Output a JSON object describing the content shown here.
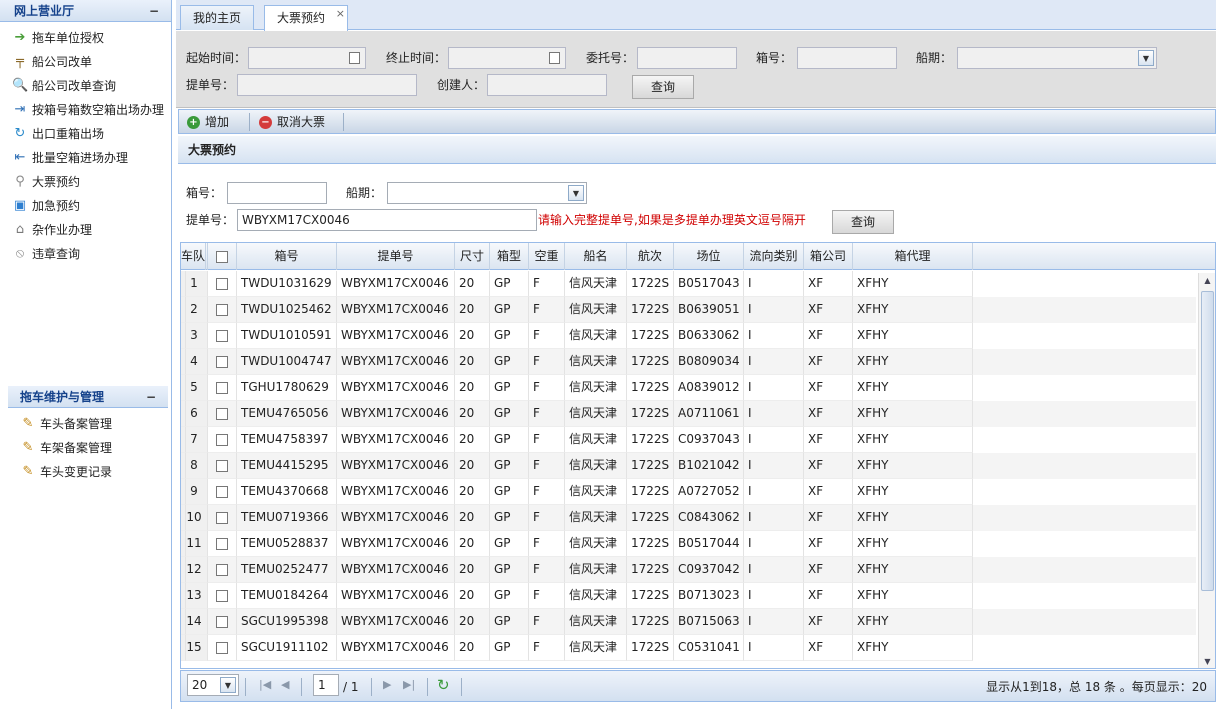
{
  "sidebar": {
    "title": "网上营业厅",
    "collapse": "−",
    "items": [
      {
        "label": "拖车单位授权",
        "icon": "arrow-right-icon",
        "glyph": "➔",
        "color": "#4a9e3a"
      },
      {
        "label": "船公司改单",
        "icon": "hammer-icon",
        "glyph": "╤",
        "color": "#8b6a2b"
      },
      {
        "label": "船公司改单查询",
        "icon": "magnifier-icon",
        "glyph": "🔍",
        "color": "#555"
      },
      {
        "label": "按箱号箱数空箱出场办理",
        "icon": "door-out-icon",
        "glyph": "⇥",
        "color": "#2f6fb5"
      },
      {
        "label": "出口重箱出场",
        "icon": "refresh-icon",
        "glyph": "↻",
        "color": "#2a8acb"
      },
      {
        "label": "批量空箱进场办理",
        "icon": "door-in-icon",
        "glyph": "⇤",
        "color": "#2f6fb5"
      },
      {
        "label": "大票预约",
        "icon": "stamp-icon",
        "glyph": "⚲",
        "color": "#8a8a8a"
      },
      {
        "label": "加急预约",
        "icon": "picture-icon",
        "glyph": "▣",
        "color": "#2e7fd0"
      },
      {
        "label": "杂作业办理",
        "icon": "bank-icon",
        "glyph": "⌂",
        "color": "#7a7a7a"
      },
      {
        "label": "违章查询",
        "icon": "tag-icon",
        "glyph": "⦸",
        "color": "#8a8a8a"
      }
    ]
  },
  "sidebar2": {
    "title": "拖车维护与管理",
    "collapse": "−",
    "items": [
      {
        "label": "车头备案管理",
        "icon": "pencil-icon",
        "glyph": "✎",
        "color": "#c28a1a"
      },
      {
        "label": "车架备案管理",
        "icon": "pencil-icon",
        "glyph": "✎",
        "color": "#c28a1a"
      },
      {
        "label": "车头变更记录",
        "icon": "pencil-icon",
        "glyph": "✎",
        "color": "#c28a1a"
      }
    ]
  },
  "tabs": [
    {
      "label": "我的主页"
    },
    {
      "label": "大票预约",
      "close": "×"
    }
  ],
  "filter": {
    "start_label": "起始时间：",
    "end_label": "终止时间：",
    "consign_label": "委托号：",
    "box_label": "箱号：",
    "voyage_label": "船期：",
    "bill_label": "提单号：",
    "creator_label": "创建人：",
    "query_label": "查询"
  },
  "toolbar": {
    "add_label": "增加",
    "cancel_label": "取消大票"
  },
  "section_title": "大票预约",
  "form": {
    "box_label": "箱号：",
    "voyage_label": "船期：",
    "bill_label": "提单号：",
    "bill_value": "WBYXM17CX0046",
    "hint": "请输入完整提单号,如果是多提单办理英文逗号隔开",
    "query_label": "查询"
  },
  "grid": {
    "columns": [
      "箱号",
      "提单号",
      "尺寸",
      "箱型",
      "空重",
      "船名",
      "航次",
      "场位",
      "流向类别",
      "箱公司",
      "箱代理",
      "车队"
    ],
    "rows": [
      [
        "1",
        "TWDU1031629",
        "WBYXM17CX0046",
        "20",
        "GP",
        "F",
        "信风天津",
        "1722S",
        "B0517043",
        "I",
        "XF",
        "XFHY",
        ""
      ],
      [
        "2",
        "TWDU1025462",
        "WBYXM17CX0046",
        "20",
        "GP",
        "F",
        "信风天津",
        "1722S",
        "B0639051",
        "I",
        "XF",
        "XFHY",
        ""
      ],
      [
        "3",
        "TWDU1010591",
        "WBYXM17CX0046",
        "20",
        "GP",
        "F",
        "信风天津",
        "1722S",
        "B0633062",
        "I",
        "XF",
        "XFHY",
        ""
      ],
      [
        "4",
        "TWDU1004747",
        "WBYXM17CX0046",
        "20",
        "GP",
        "F",
        "信风天津",
        "1722S",
        "B0809034",
        "I",
        "XF",
        "XFHY",
        ""
      ],
      [
        "5",
        "TGHU1780629",
        "WBYXM17CX0046",
        "20",
        "GP",
        "F",
        "信风天津",
        "1722S",
        "A0839012",
        "I",
        "XF",
        "XFHY",
        ""
      ],
      [
        "6",
        "TEMU4765056",
        "WBYXM17CX0046",
        "20",
        "GP",
        "F",
        "信风天津",
        "1722S",
        "A0711061",
        "I",
        "XF",
        "XFHY",
        ""
      ],
      [
        "7",
        "TEMU4758397",
        "WBYXM17CX0046",
        "20",
        "GP",
        "F",
        "信风天津",
        "1722S",
        "C0937043",
        "I",
        "XF",
        "XFHY",
        ""
      ],
      [
        "8",
        "TEMU4415295",
        "WBYXM17CX0046",
        "20",
        "GP",
        "F",
        "信风天津",
        "1722S",
        "B1021042",
        "I",
        "XF",
        "XFHY",
        ""
      ],
      [
        "9",
        "TEMU4370668",
        "WBYXM17CX0046",
        "20",
        "GP",
        "F",
        "信风天津",
        "1722S",
        "A0727052",
        "I",
        "XF",
        "XFHY",
        ""
      ],
      [
        "10",
        "TEMU0719366",
        "WBYXM17CX0046",
        "20",
        "GP",
        "F",
        "信风天津",
        "1722S",
        "C0843062",
        "I",
        "XF",
        "XFHY",
        ""
      ],
      [
        "11",
        "TEMU0528837",
        "WBYXM17CX0046",
        "20",
        "GP",
        "F",
        "信风天津",
        "1722S",
        "B0517044",
        "I",
        "XF",
        "XFHY",
        ""
      ],
      [
        "12",
        "TEMU0252477",
        "WBYXM17CX0046",
        "20",
        "GP",
        "F",
        "信风天津",
        "1722S",
        "C0937042",
        "I",
        "XF",
        "XFHY",
        ""
      ],
      [
        "13",
        "TEMU0184264",
        "WBYXM17CX0046",
        "20",
        "GP",
        "F",
        "信风天津",
        "1722S",
        "B0713023",
        "I",
        "XF",
        "XFHY",
        ""
      ],
      [
        "14",
        "SGCU1995398",
        "WBYXM17CX0046",
        "20",
        "GP",
        "F",
        "信风天津",
        "1722S",
        "B0715063",
        "I",
        "XF",
        "XFHY",
        ""
      ],
      [
        "15",
        "SGCU1911102",
        "WBYXM17CX0046",
        "20",
        "GP",
        "F",
        "信风天津",
        "1722S",
        "C0531041",
        "I",
        "XF",
        "XFHY",
        ""
      ]
    ]
  },
  "pager": {
    "page_size": "20",
    "page": "1",
    "total_pages": "/ 1",
    "summary": "显示从1到18，总 18 条 。每页显示：20"
  }
}
